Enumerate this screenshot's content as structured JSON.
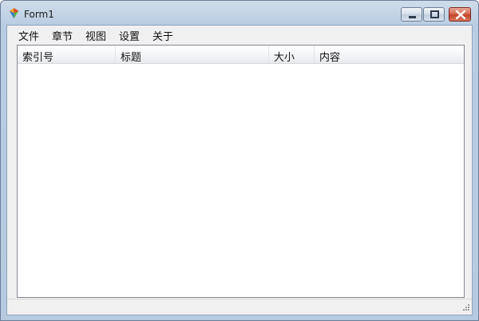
{
  "window": {
    "title": "Form1",
    "app_icon": "app-logo-icon"
  },
  "controls": {
    "minimize": "minimize-icon",
    "maximize": "maximize-icon",
    "close": "close-icon"
  },
  "menu": [
    "文件",
    "章节",
    "视图",
    "设置",
    "关于"
  ],
  "list": {
    "columns": [
      "索引号",
      "标题",
      "大小",
      "内容"
    ],
    "rows": []
  },
  "colors": {
    "accent_close": "#c3432a",
    "frame": "#b9cde2"
  }
}
